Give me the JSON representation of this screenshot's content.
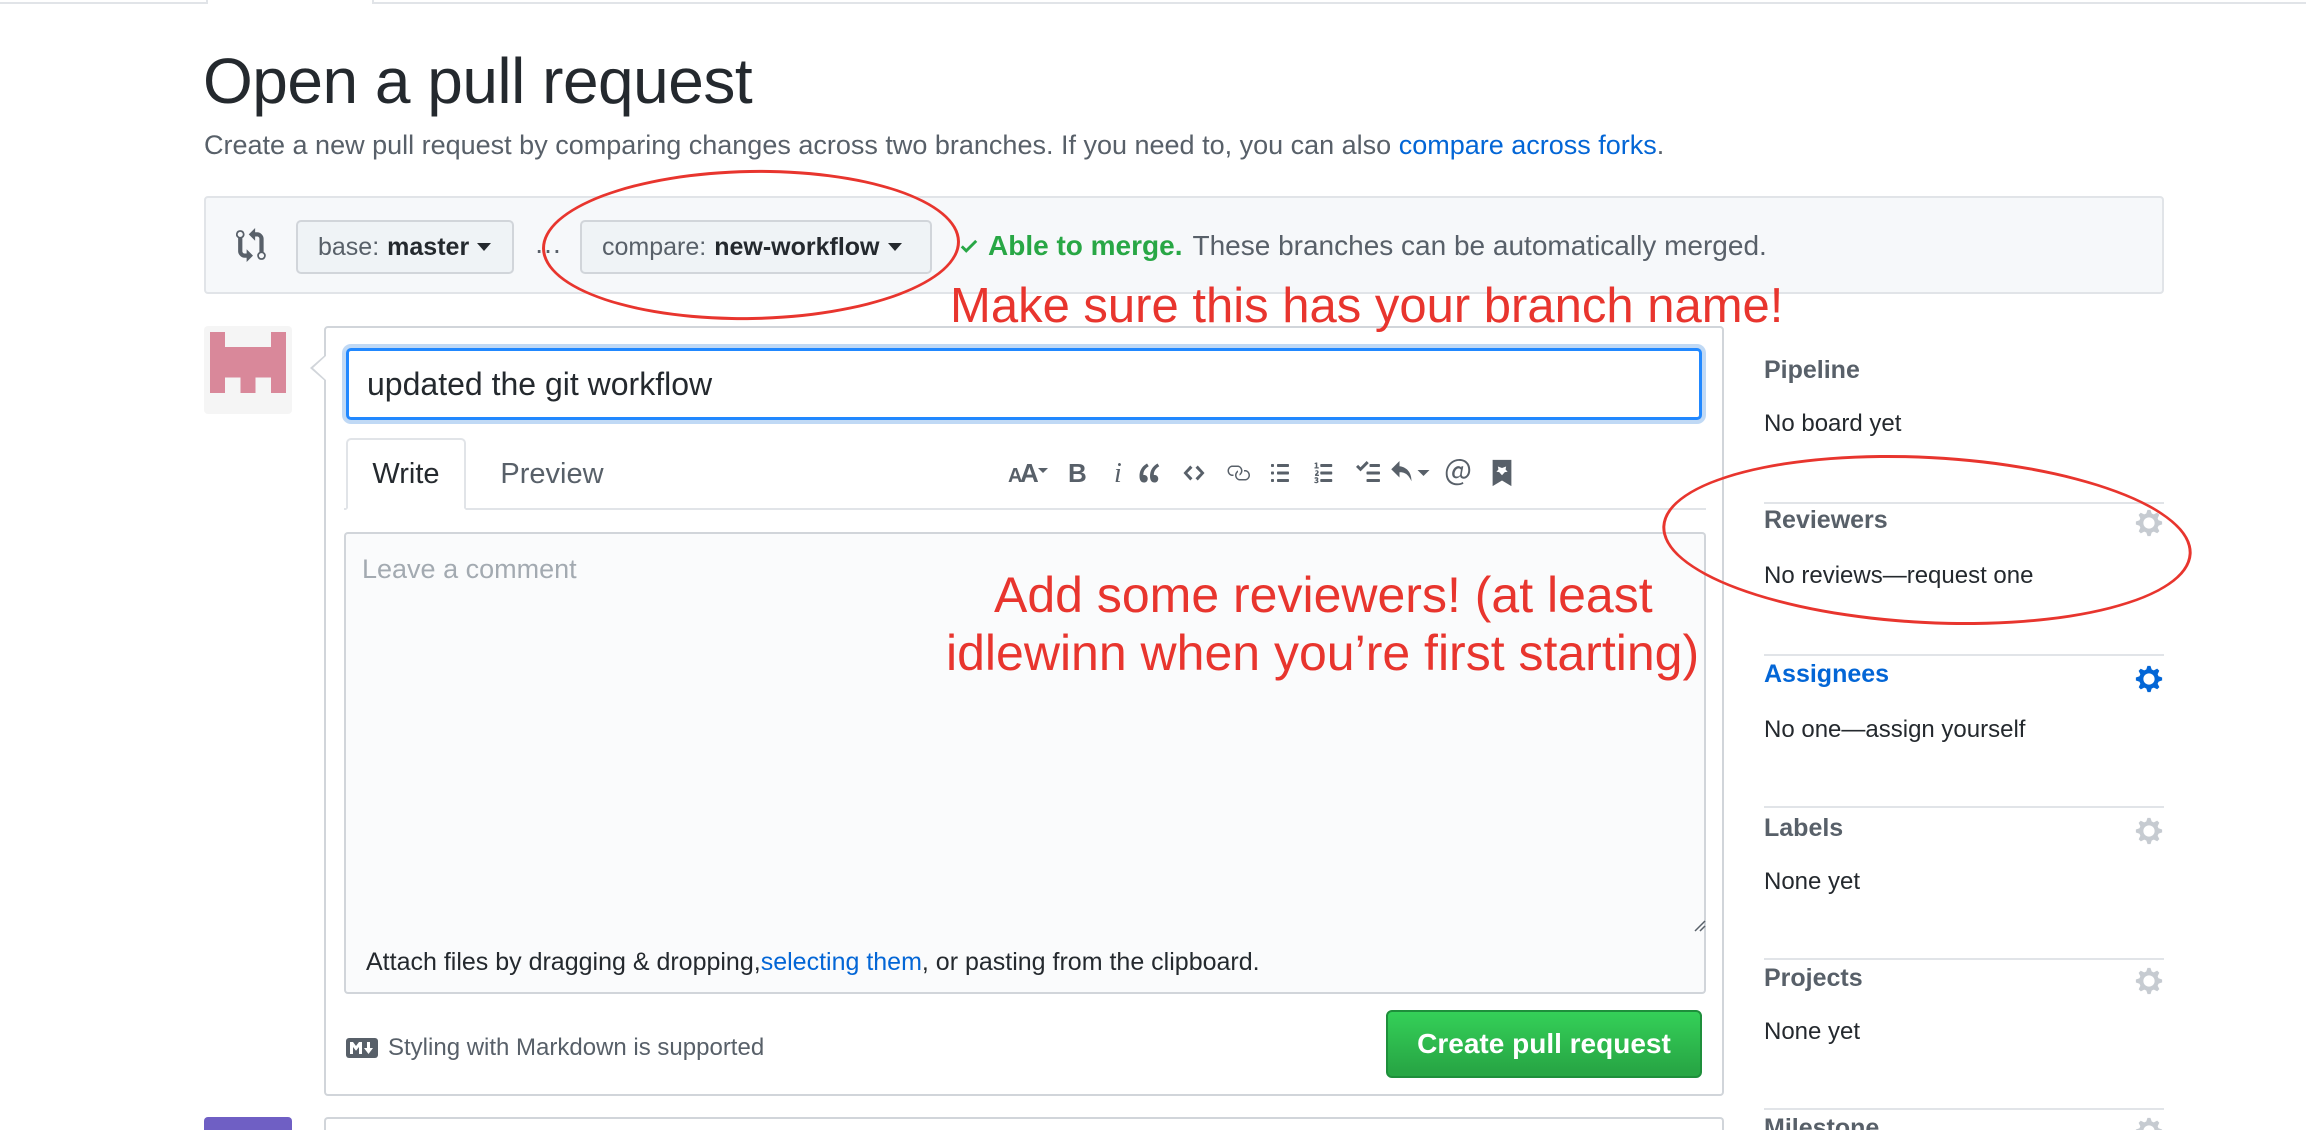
{
  "page": {
    "title": "Open a pull request",
    "subtitle": "Create a new pull request by comparing changes across two branches. If you need to, you can also ",
    "subtitle_link": "compare across forks",
    "subtitle_end": "."
  },
  "range": {
    "base_prefix": "base:",
    "base_branch": "master",
    "separator": "…",
    "compare_prefix": "compare:",
    "compare_branch": "new-workflow",
    "merge_ok": "Able to merge.",
    "merge_text": "These branches can be automatically merged."
  },
  "composer": {
    "title_value": "updated the git workflow",
    "tabs": [
      {
        "label": "Write",
        "active": true
      },
      {
        "label": "Preview",
        "active": false
      }
    ],
    "toolbar_icons": [
      "text-size-icon",
      "bold-icon",
      "italic-icon",
      "quote-icon",
      "code-icon",
      "link-icon",
      "bullet-list-icon",
      "numbered-list-icon",
      "task-list-icon",
      "reply-icon",
      "mention-icon",
      "saved-reply-icon"
    ],
    "comment_placeholder": "Leave a comment",
    "attach_prefix": "Attach files by dragging & dropping, ",
    "attach_link": "selecting them",
    "attach_suffix": ", or pasting from the clipboard.",
    "markdown_note": "Styling with Markdown is supported",
    "submit_label": "Create pull request"
  },
  "sidebar": {
    "pipeline": {
      "label": "Pipeline",
      "value": "No board yet"
    },
    "reviewers": {
      "label": "Reviewers",
      "value": "No reviews—request one"
    },
    "assignees": {
      "label": "Assignees",
      "value": "No one—assign yourself"
    },
    "labels": {
      "label": "Labels",
      "value": "None yet"
    },
    "projects": {
      "label": "Projects",
      "value": "None yet"
    },
    "milestone": {
      "label": "Milestone"
    }
  },
  "annotations": {
    "branch_note": "Make sure this has your branch name!",
    "reviewers_line1": "Add some reviewers! (at least",
    "reviewers_line2": "idlewinn when you’re first starting)"
  },
  "colors": {
    "link": "#0366d6",
    "success": "#28a745",
    "annotation": "#e8352e",
    "focus": "#2188ff"
  }
}
